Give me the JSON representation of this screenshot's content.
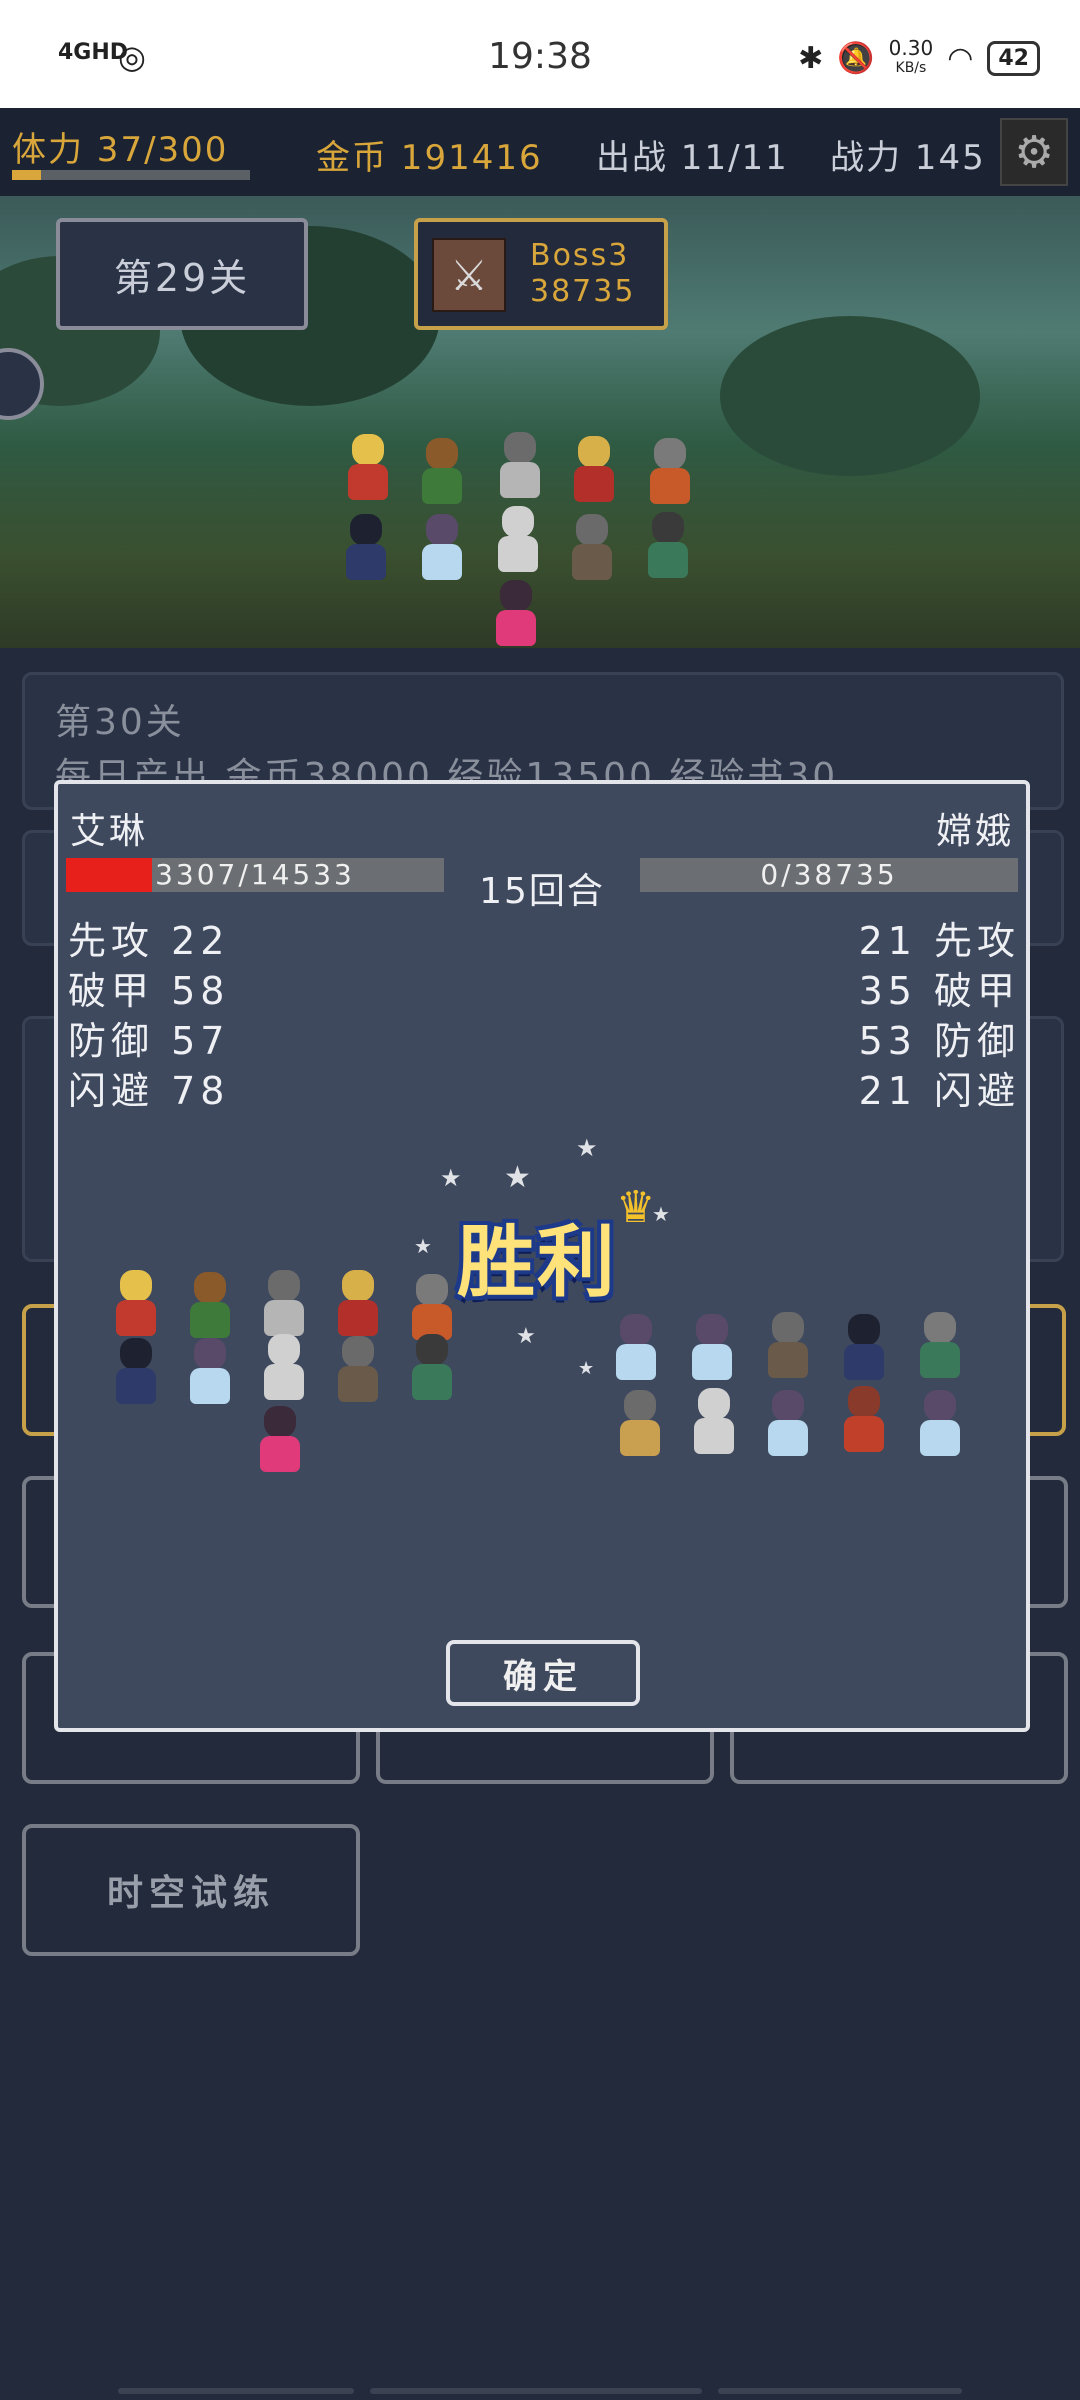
{
  "status_bar": {
    "network": "4GHD",
    "time": "19:38",
    "speed_value": "0.30",
    "speed_unit": "KB/s",
    "battery": "42"
  },
  "top_bar": {
    "stamina": "体力 37/300",
    "stamina_fraction": 0.123,
    "gold": "金币 191416",
    "deploy": "出战 11/11",
    "power": "战力 145"
  },
  "battle_area": {
    "current_stage": "第29关",
    "boss_name": "Boss3",
    "boss_hp": "38735"
  },
  "next_stage": {
    "title": "第30关",
    "daily_output": "每日产出 金币38000 经验13500 经验书30"
  },
  "menu": {
    "trial_label": "时空试练"
  },
  "result_popup": {
    "left_name": "艾琳",
    "right_name": "嫦娥",
    "left_hp_text": "3307/14533",
    "left_hp_fraction": 0.2275,
    "right_hp_text": "0/38735",
    "right_hp_fraction": 0,
    "rounds": "15回合",
    "left_stats": [
      "先攻 22",
      "破甲 58",
      "防御 57",
      "闪避 78"
    ],
    "right_stats": [
      "21 先攻",
      "35 破甲",
      "53 防御",
      "21 闪避"
    ],
    "victory_text": "胜利",
    "confirm_label": "确定"
  },
  "colors": {
    "accent_gold": "#d8a63a",
    "hp_red": "#e8201c",
    "panel": "#3f495e"
  }
}
